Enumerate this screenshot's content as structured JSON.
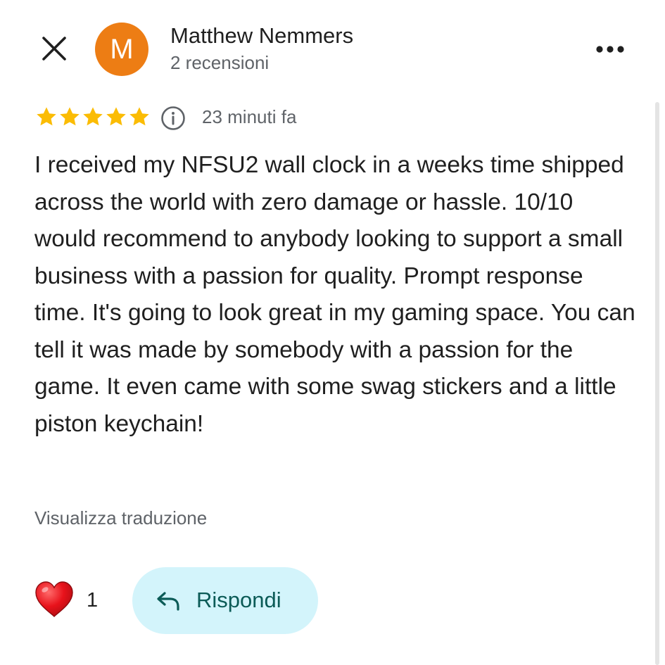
{
  "header": {
    "avatar_initial": "M",
    "author_name": "Matthew Nemmers",
    "author_reviews": "2 recensioni"
  },
  "review": {
    "rating": 5,
    "rating_max": 5,
    "time": "23 minuti fa",
    "text": "I received my NFSU2 wall clock in a weeks time shipped across the world with zero damage or hassle. 10/10 would recommend to anybody looking to support a small business with a passion for quality. Prompt response time. It's going to look great in my gaming space. You can tell it was made by somebody with a passion for the game. It even came with some swag stickers and a little piston keychain!",
    "translate_link": "Visualizza traduzione"
  },
  "actions": {
    "like_count": "1",
    "reply_label": "Rispondi"
  },
  "icons": {
    "close": "close-icon",
    "more": "more-options-icon",
    "star": "star-icon",
    "info": "info-icon",
    "heart": "heart-icon",
    "reply": "reply-arrow-icon"
  },
  "colors": {
    "avatar": "#ed7d14",
    "star": "#fbbc04",
    "reply_button_bg": "#d3f4fb",
    "reply_button_text": "#0b5b57",
    "heart": "#e8121b"
  }
}
